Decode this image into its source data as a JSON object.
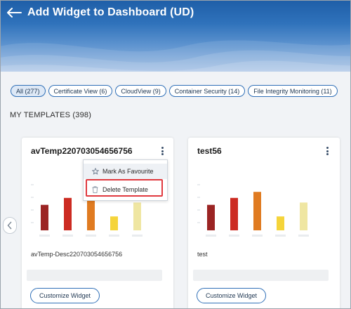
{
  "header": {
    "title": "Add Widget to Dashboard (UD)",
    "back_icon": "arrow-left-icon"
  },
  "filters": [
    {
      "label": "All (277)",
      "active": true
    },
    {
      "label": "Certificate View (6)"
    },
    {
      "label": "CloudView (9)"
    },
    {
      "label": "Container Security (14)"
    },
    {
      "label": "File Integrity Monitoring (11)"
    }
  ],
  "section": {
    "title": "MY TEMPLATES (398)"
  },
  "cards": [
    {
      "title": "avTemp220703054656756",
      "description": "avTemp-Desc220703054656756",
      "button": "Customize Widget",
      "bars": [
        {
          "value": 0.55,
          "color": "#9b2423"
        },
        {
          "value": 0.7,
          "color": "#cc2b22"
        },
        {
          "value": 0.78,
          "color": "#e07b21"
        },
        {
          "value": 0.3,
          "color": "#f5d43a"
        },
        {
          "value": 0.6,
          "color": "#efe6a2"
        }
      ]
    },
    {
      "title": "test56",
      "description": "test",
      "button": "Customize Widget",
      "bars": [
        {
          "value": 0.55,
          "color": "#9b2423"
        },
        {
          "value": 0.7,
          "color": "#cc2b22"
        },
        {
          "value": 0.83,
          "color": "#e07b21"
        },
        {
          "value": 0.3,
          "color": "#f5d43a"
        },
        {
          "value": 0.6,
          "color": "#efe6a2"
        }
      ]
    }
  ],
  "menu": {
    "favourite": "Mark As Favourite",
    "delete": "Delete Template"
  },
  "colors": {
    "accent": "#2f6fb7",
    "highlight": "#e0393e"
  }
}
